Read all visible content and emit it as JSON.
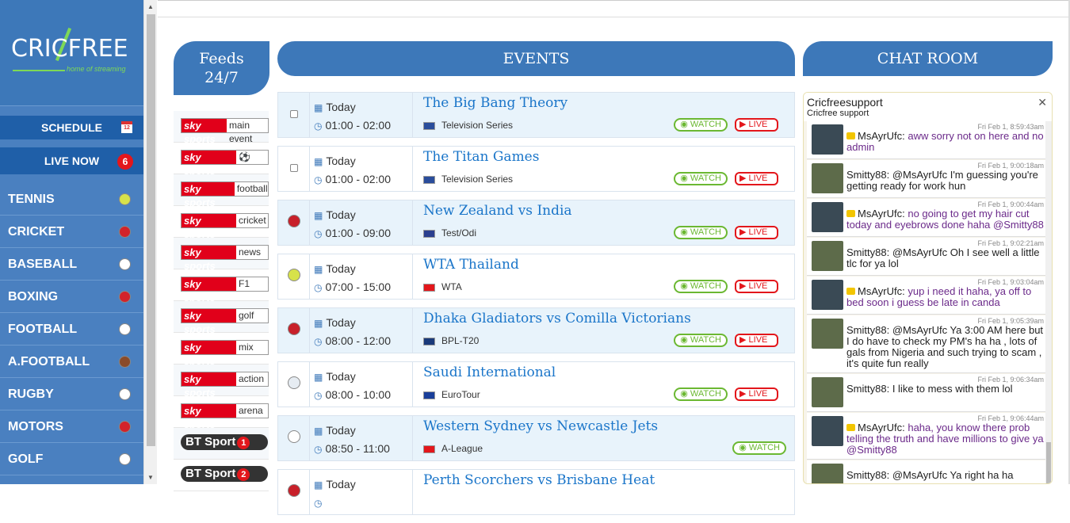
{
  "sidebar": {
    "logo": "CRICFREE",
    "logo_tag": "home of streaming",
    "schedule_label": "SCHEDULE",
    "schedule_icon_text": "12",
    "live_now_label": "LIVE NOW",
    "live_count": "6",
    "sports": [
      {
        "label": "TENNIS",
        "icon": "tennis-ball-icon",
        "color": "#d7e24a"
      },
      {
        "label": "CRICKET",
        "icon": "cricket-ball-icon",
        "color": "#d2232a"
      },
      {
        "label": "BASEBALL",
        "icon": "baseball-icon",
        "color": "#ffffff"
      },
      {
        "label": "BOXING",
        "icon": "boxing-glove-icon",
        "color": "#d2232a"
      },
      {
        "label": "FOOTBALL",
        "icon": "soccer-ball-icon",
        "color": "#ffffff"
      },
      {
        "label": "A.FOOTBALL",
        "icon": "american-football-icon",
        "color": "#8a4b2a"
      },
      {
        "label": "RUGBY",
        "icon": "rugby-ball-icon",
        "color": "#ffffff"
      },
      {
        "label": "MOTORS",
        "icon": "racing-car-icon",
        "color": "#d2232a"
      },
      {
        "label": "GOLF",
        "icon": "golf-ball-icon",
        "color": "#ffffff"
      }
    ]
  },
  "feeds": {
    "title_line1": "Feeds",
    "title_line2": "24/7",
    "items": [
      {
        "brand": "sky sports",
        "channel": "main event"
      },
      {
        "brand": "sky sports",
        "channel": "⚽"
      },
      {
        "brand": "sky sports",
        "channel": "football"
      },
      {
        "brand": "sky sports",
        "channel": "cricket"
      },
      {
        "brand": "sky sports",
        "channel": "news"
      },
      {
        "brand": "sky sports",
        "channel": "F1"
      },
      {
        "brand": "sky sports",
        "channel": "golf"
      },
      {
        "brand": "sky sports",
        "channel": "mix"
      },
      {
        "brand": "sky sports",
        "channel": "action"
      },
      {
        "brand": "sky sports",
        "channel": "arena"
      },
      {
        "brand": "BT Sport",
        "channel": "1"
      },
      {
        "brand": "BT Sport",
        "channel": "2"
      }
    ]
  },
  "events": {
    "title": "EVENTS",
    "watch_label": "WATCH",
    "live_label": "LIVE",
    "items": [
      {
        "day": "Today",
        "time": "01:00 - 02:00",
        "title": "The Big Bang Theory",
        "category": "Television Series",
        "flag": "uk",
        "icon": "checkbox",
        "live": true
      },
      {
        "day": "Today",
        "time": "01:00 - 02:00",
        "title": "The Titan Games",
        "category": "Television Series",
        "flag": "uk",
        "icon": "checkbox",
        "live": true
      },
      {
        "day": "Today",
        "time": "01:00 - 09:00",
        "title": "New Zealand vs India",
        "category": "Test/Odi",
        "flag": "intl",
        "icon": "cricket",
        "live": true
      },
      {
        "day": "Today",
        "time": "07:00 - 15:00",
        "title": "WTA Thailand",
        "category": "WTA",
        "flag": "wta",
        "icon": "tennis",
        "live": true
      },
      {
        "day": "Today",
        "time": "08:00 - 12:00",
        "title": "Dhaka Gladiators vs Comilla Victorians",
        "category": "BPL-T20",
        "flag": "bd",
        "icon": "cricket",
        "live": true
      },
      {
        "day": "Today",
        "time": "08:00 - 10:00",
        "title": "Saudi International",
        "category": "EuroTour",
        "flag": "eu",
        "icon": "golf",
        "live": true
      },
      {
        "day": "Today",
        "time": "08:50 - 11:00",
        "title": "Western Sydney vs Newcastle Jets",
        "category": "A-League",
        "flag": "aus",
        "icon": "soccer",
        "live": false
      },
      {
        "day": "Today",
        "time": "",
        "title": "Perth Scorchers vs Brisbane Heat",
        "category": "",
        "flag": "",
        "icon": "cricket",
        "live": false
      }
    ]
  },
  "chat": {
    "title": "CHAT ROOM",
    "room_name": "Cricfreesupport",
    "room_sub": "Cricfree support",
    "messages": [
      {
        "user": "MsAyrUfc:",
        "time": "Fri Feb 1, 8:59:43am",
        "text": "aww sorry not on here and no admin",
        "mod": true
      },
      {
        "user": "Smitty88:",
        "time": "Fri Feb 1, 9:00:18am",
        "text": "@MsAyrUfc I'm guessing you're getting ready for work hun",
        "mod": false
      },
      {
        "user": "MsAyrUfc:",
        "time": "Fri Feb 1, 9:00:44am",
        "text": "no going to get my hair cut today and eyebrows done haha @Smitty88",
        "mod": true
      },
      {
        "user": "Smitty88:",
        "time": "Fri Feb 1, 9:02:21am",
        "text": "@MsAyrUfc Oh I see well a little tlc for ya lol",
        "mod": false
      },
      {
        "user": "MsAyrUfc:",
        "time": "Fri Feb 1, 9:03:04am",
        "text": "yup i need it haha, ya off to bed soon i guess be late in canda",
        "mod": true
      },
      {
        "user": "Smitty88:",
        "time": "Fri Feb 1, 9:05:39am",
        "text": "@MsAyrUfc Ya 3:00 AM here but I do have to check my PM's ha ha , lots of gals from Nigeria and such trying to scam , it's quite fun really",
        "mod": false
      },
      {
        "user": "Smitty88:",
        "time": "Fri Feb 1, 9:06:34am",
        "text": "I like to mess with them lol",
        "mod": false
      },
      {
        "user": "MsAyrUfc:",
        "time": "Fri Feb 1, 9:06:44am",
        "text": "haha, you know there prob telling the truth and have millions to give ya @Smitty88",
        "mod": true
      },
      {
        "user": "Smitty88:",
        "time": "",
        "text": "@MsAyrUfc Ya right ha ha",
        "mod": false
      }
    ]
  },
  "colors": {
    "brand_blue": "#3d78b9",
    "sidebar_blue": "#4a80c0",
    "watch_green": "#6bb832",
    "live_red": "#e3161b",
    "title_blue": "#1a75c9"
  }
}
